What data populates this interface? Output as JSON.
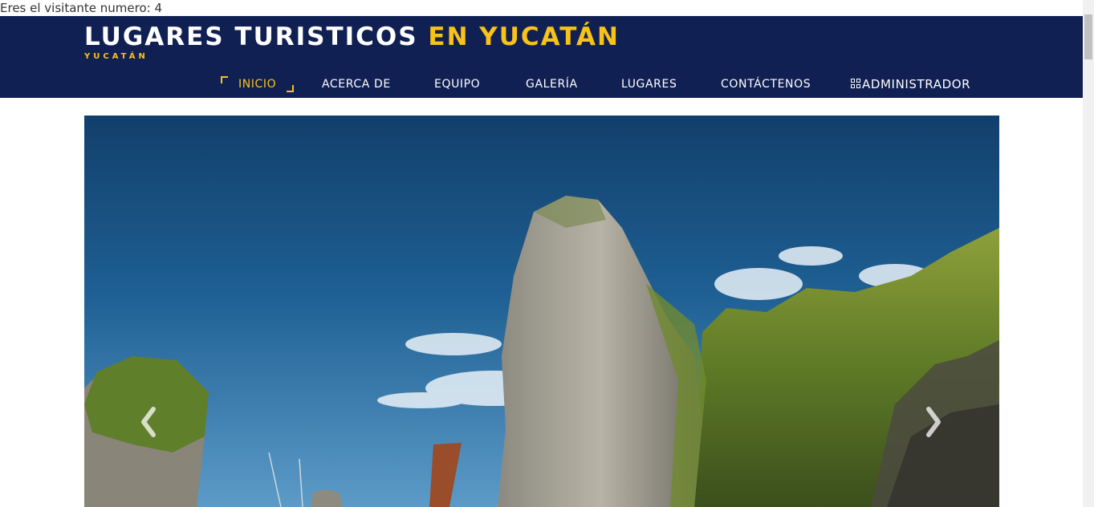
{
  "visitor": {
    "text": "Eres el visitante numero: 4"
  },
  "header": {
    "title_main": "LUGARES TURISTICOS",
    "title_accent": "EN YUCATÁN",
    "subtitle": "YUCATÁN"
  },
  "nav": {
    "items": [
      {
        "label": "INICIO",
        "active": true
      },
      {
        "label": "ACERCA DE",
        "active": false
      },
      {
        "label": "EQUIPO",
        "active": false
      },
      {
        "label": "GALERÍA",
        "active": false
      },
      {
        "label": "LUGARES",
        "active": false
      },
      {
        "label": "CONTÁCTENOS",
        "active": false
      },
      {
        "label": "ADMINISTRADOR",
        "active": false,
        "icon": "qrcode-icon"
      }
    ]
  },
  "carousel": {
    "image": "limestone-karst-sea-photo",
    "prev_icon": "chevron-left-icon",
    "next_icon": "chevron-right-icon"
  },
  "colors": {
    "header_bg": "#112053",
    "accent": "#f9c218",
    "nav_text": "#ffffff"
  }
}
